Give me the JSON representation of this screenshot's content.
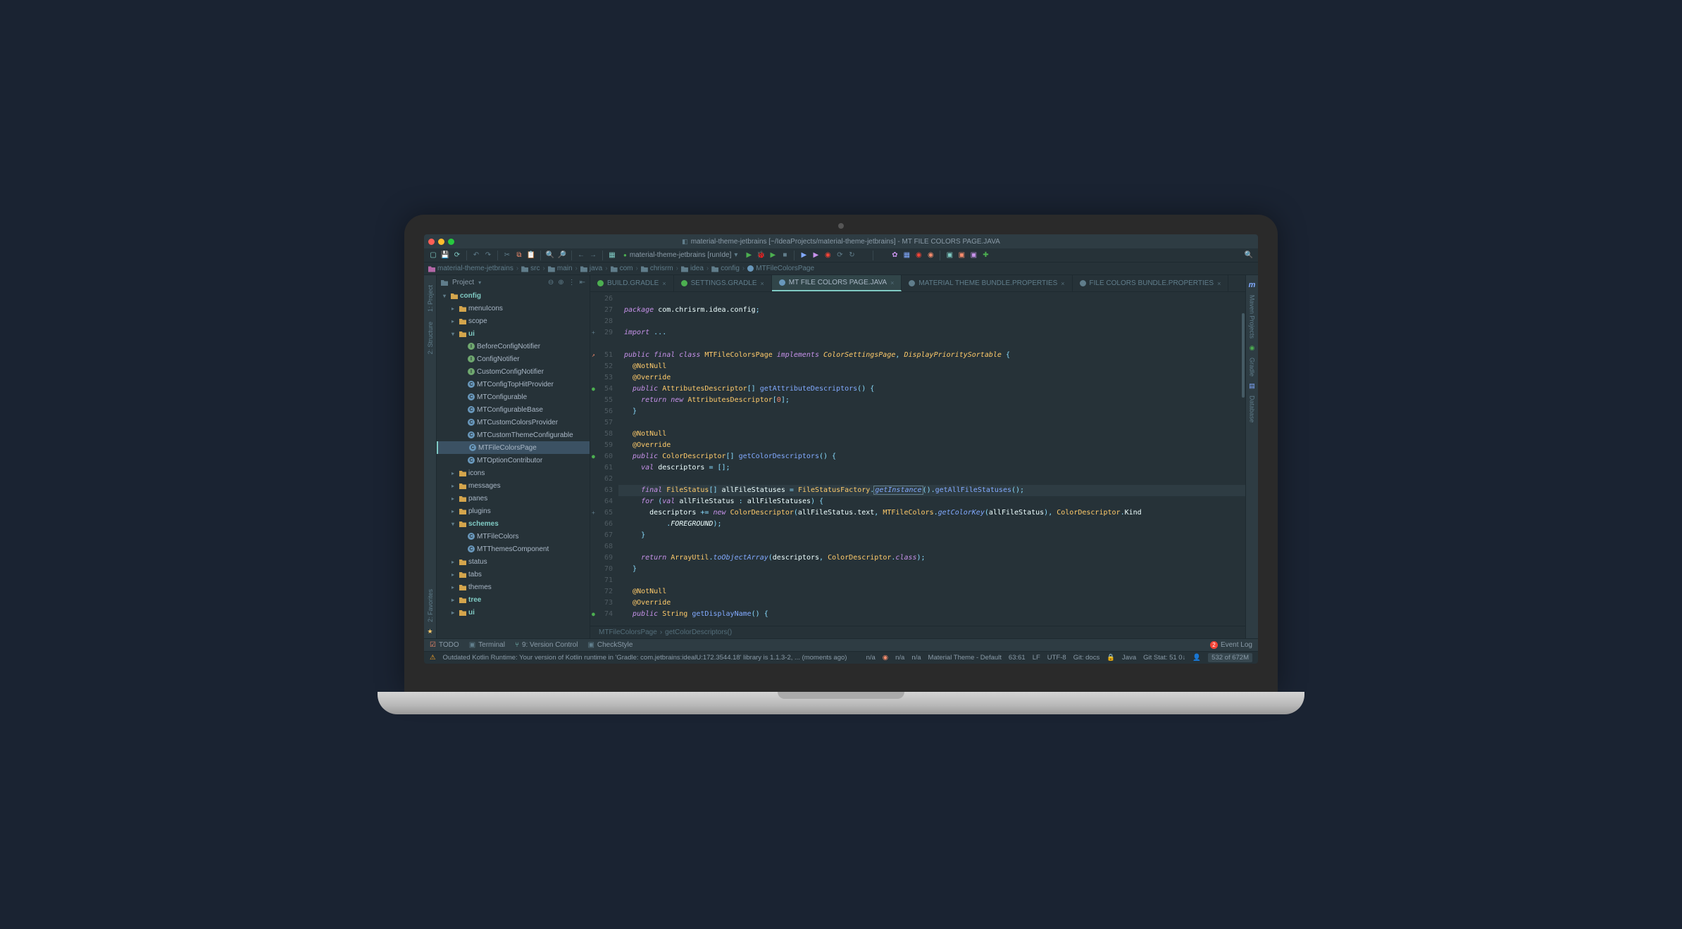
{
  "title": "material-theme-jetbrains [~/IdeaProjects/material-theme-jetbrains] - MT FILE COLORS PAGE.JAVA",
  "run_config": "material-theme-jetbrains [runIde]",
  "breadcrumb": [
    {
      "icon": "pkg",
      "label": "material-theme-jetbrains"
    },
    {
      "icon": "folder",
      "label": "src"
    },
    {
      "icon": "folder",
      "label": "main"
    },
    {
      "icon": "folder",
      "label": "java"
    },
    {
      "icon": "folder",
      "label": "com"
    },
    {
      "icon": "folder",
      "label": "chrisrm"
    },
    {
      "icon": "folder",
      "label": "idea"
    },
    {
      "icon": "folder",
      "label": "config"
    },
    {
      "icon": "java",
      "label": "MTFileColorsPage"
    }
  ],
  "project_label": "Project",
  "left_vtabs": [
    {
      "label": "1: Project",
      "key": "project"
    },
    {
      "label": "2: Structure",
      "key": "structure"
    },
    {
      "label": "2: Favorites",
      "key": "favorites"
    }
  ],
  "right_vtabs": [
    {
      "label": "Maven Projects",
      "key": "maven",
      "icon": "m"
    },
    {
      "label": "Gradle",
      "key": "gradle"
    },
    {
      "label": "Database",
      "key": "database"
    }
  ],
  "tree": [
    {
      "depth": 0,
      "arrow": "▾",
      "icon": "folder-y",
      "label": "config",
      "bold": true
    },
    {
      "depth": 1,
      "arrow": "▸",
      "icon": "folder-y",
      "label": "menuIcons"
    },
    {
      "depth": 1,
      "arrow": "▸",
      "icon": "folder-y",
      "label": "scope"
    },
    {
      "depth": 1,
      "arrow": "▾",
      "icon": "folder-y",
      "label": "ui",
      "bold": true
    },
    {
      "depth": 2,
      "arrow": "",
      "icon": "cls-i",
      "label": "BeforeConfigNotifier"
    },
    {
      "depth": 2,
      "arrow": "",
      "icon": "cls-i",
      "label": "ConfigNotifier"
    },
    {
      "depth": 2,
      "arrow": "",
      "icon": "cls-i",
      "label": "CustomConfigNotifier"
    },
    {
      "depth": 2,
      "arrow": "",
      "icon": "cls-c",
      "label": "MTConfigTopHitProvider"
    },
    {
      "depth": 2,
      "arrow": "",
      "icon": "cls-c",
      "label": "MTConfigurable"
    },
    {
      "depth": 2,
      "arrow": "",
      "icon": "cls-c",
      "label": "MTConfigurableBase"
    },
    {
      "depth": 2,
      "arrow": "",
      "icon": "cls-c",
      "label": "MTCustomColorsProvider"
    },
    {
      "depth": 2,
      "arrow": "",
      "icon": "cls-c",
      "label": "MTCustomThemeConfigurable"
    },
    {
      "depth": 2,
      "arrow": "",
      "icon": "cls-c",
      "label": "MTFileColorsPage",
      "selected": true
    },
    {
      "depth": 2,
      "arrow": "",
      "icon": "cls-c",
      "label": "MTOptionContributor"
    },
    {
      "depth": 1,
      "arrow": "▸",
      "icon": "folder-y",
      "label": "icons"
    },
    {
      "depth": 1,
      "arrow": "▸",
      "icon": "folder-y",
      "label": "messages"
    },
    {
      "depth": 1,
      "arrow": "▸",
      "icon": "folder-y",
      "label": "panes"
    },
    {
      "depth": 1,
      "arrow": "▸",
      "icon": "folder-y",
      "label": "plugins"
    },
    {
      "depth": 1,
      "arrow": "▾",
      "icon": "folder-y",
      "label": "schemes",
      "bold": true
    },
    {
      "depth": 2,
      "arrow": "",
      "icon": "cls-c",
      "label": "MTFileColors"
    },
    {
      "depth": 2,
      "arrow": "",
      "icon": "cls-c",
      "label": "MTThemesComponent"
    },
    {
      "depth": 1,
      "arrow": "▸",
      "icon": "folder-y",
      "label": "status"
    },
    {
      "depth": 1,
      "arrow": "▸",
      "icon": "folder-y",
      "label": "tabs"
    },
    {
      "depth": 1,
      "arrow": "▸",
      "icon": "folder-y",
      "label": "themes"
    },
    {
      "depth": 1,
      "arrow": "▸",
      "icon": "folder-y",
      "label": "tree",
      "bold": true
    },
    {
      "depth": 1,
      "arrow": "▸",
      "icon": "folder-y",
      "label": "ui",
      "bold": true
    }
  ],
  "tabs": [
    {
      "label": "BUILD.GRADLE",
      "icon": "gradle",
      "active": false
    },
    {
      "label": "SETTINGS.GRADLE",
      "icon": "gradle",
      "active": false
    },
    {
      "label": "MT FILE COLORS PAGE.JAVA",
      "icon": "java",
      "active": true
    },
    {
      "label": "MATERIAL THEME BUNDLE.PROPERTIES",
      "icon": "prop",
      "active": false
    },
    {
      "label": "FILE COLORS BUNDLE.PROPERTIES",
      "icon": "prop",
      "active": false
    }
  ],
  "gutter_start": 26,
  "gutter_lines": [
    {
      "n": 26
    },
    {
      "n": 27
    },
    {
      "n": 28
    },
    {
      "n": 29,
      "mark": "+"
    },
    {
      "n": ""
    },
    {
      "n": 51,
      "mark": "↗"
    },
    {
      "n": 52
    },
    {
      "n": 53
    },
    {
      "n": 54,
      "mark": "●"
    },
    {
      "n": 55
    },
    {
      "n": 56
    },
    {
      "n": 57
    },
    {
      "n": 58
    },
    {
      "n": 59
    },
    {
      "n": 60,
      "mark": "●"
    },
    {
      "n": 61
    },
    {
      "n": 62
    },
    {
      "n": 63
    },
    {
      "n": 64
    },
    {
      "n": 65,
      "mark": "+"
    },
    {
      "n": 66
    },
    {
      "n": 67
    },
    {
      "n": 68
    },
    {
      "n": 69
    },
    {
      "n": 70
    },
    {
      "n": 71
    },
    {
      "n": 72
    },
    {
      "n": 73
    },
    {
      "n": 74,
      "mark": "●"
    }
  ],
  "code": {
    "pkg": "package com.chrisrm.idea.config;",
    "imp": "import ...",
    "cls_decl": {
      "p1": "public final class ",
      "cls": "MTFileColorsPage",
      "p2": " implements ",
      "i1": "ColorSettingsPage",
      "c": ", ",
      "i2": "DisplayPrioritySortable",
      "end": " {"
    },
    "ann_notnull": "@NotNull",
    "ann_override": "@Override",
    "m1": {
      "p1": "public ",
      "ret": "AttributesDescriptor",
      "arr": "[] ",
      "fn": "getAttributeDescriptors",
      "end": "() {"
    },
    "m1_body": {
      "p1": "return new ",
      "cls": "AttributesDescriptor",
      "end": "[0];"
    },
    "brace_close": "}",
    "m2": {
      "p1": "public ",
      "ret": "ColorDescriptor",
      "arr": "[] ",
      "fn": "getColorDescriptors",
      "end": "() {"
    },
    "m2_l1": {
      "p1": "val ",
      "id": "descriptors",
      "end": " = [];"
    },
    "m2_l2": {
      "p1": "final ",
      "ret": "FileStatus",
      "arr": "[] ",
      "id": "allFileStatuses",
      "eq": " = ",
      "cls": "FileStatusFactory",
      "dot": ".",
      "fn": "getInstance",
      "mid": "().",
      "fn2": "getAllFileStatuses",
      "end": "();"
    },
    "m2_l3": {
      "p1": "for ",
      "paren": "(",
      "kw": "val ",
      "id": "allFileStatus",
      "colon": " : ",
      "id2": "allFileStatuses",
      "end": ") {"
    },
    "m2_l4": {
      "id": "descriptors",
      "op": " += ",
      "kw": "new ",
      "cls": "ColorDescriptor",
      "paren": "(",
      "e1": "allFileStatus.text",
      "c": ", ",
      "cls2": "MTFileColors",
      "dot": ".",
      "fn": "getColorKey",
      "paren2": "(",
      "e2": "allFileStatus",
      "paren3": ")",
      "c2": ", ",
      "cls3": "ColorDescriptor",
      "dot2": ".",
      "e3": "Kind"
    },
    "m2_l5": {
      "dot": ".",
      "c": "FOREGROUND",
      "end": ");"
    },
    "m2_ret": {
      "p1": "return ",
      "cls": "ArrayUtil",
      "dot": ".",
      "fn": "toObjectArray",
      "paren": "(",
      "e1": "descriptors",
      "c": ", ",
      "cls2": "ColorDescriptor",
      "dot2": ".",
      "kw": "class",
      "end": ");"
    },
    "m3": {
      "p1": "public ",
      "ret": "String ",
      "fn": "getDisplayName",
      "end": "() {"
    }
  },
  "editor_bc": [
    "MTFileColorsPage",
    "getColorDescriptors()"
  ],
  "bottom_tools": [
    {
      "icon": "todo",
      "label": "TODO"
    },
    {
      "icon": "terminal",
      "label": "Terminal"
    },
    {
      "icon": "vcs",
      "label": "9: Version Control"
    },
    {
      "icon": "check",
      "label": "CheckStyle"
    }
  ],
  "event_log": {
    "count": "2",
    "label": "Event Log"
  },
  "status": {
    "msg": "Outdated Kotlin Runtime: Your version of Kotlin runtime in 'Gradle: com.jetbrains:idealU:172.3544.18' library is 1.1.3-2, ... (moments ago)",
    "na1": "n/a",
    "na2": "n/a",
    "na3": "n/a",
    "theme": "Material Theme - Default",
    "pos": "63:61",
    "lf": "LF",
    "enc": "UTF-8",
    "git": "Git: docs",
    "java": "Java",
    "gitstat": "Git Stat: 51 0↓",
    "mem": "532 of 672M"
  }
}
